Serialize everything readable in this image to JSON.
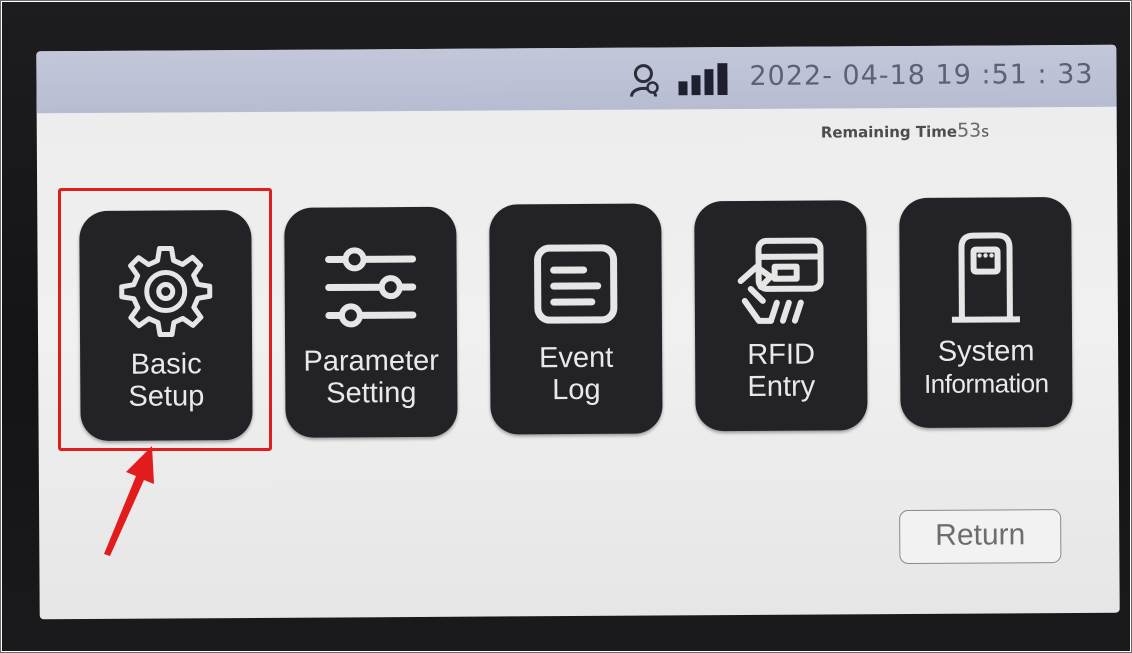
{
  "status_bar": {
    "datetime": "2022- 04-18  19 :51 : 33",
    "icons": [
      "user-icon",
      "signal-icon"
    ]
  },
  "remaining": {
    "label": "Remaining Time",
    "value": "53",
    "unit": "s"
  },
  "tiles": [
    {
      "line1": "Basic",
      "line2": "Setup",
      "icon": "gear-icon"
    },
    {
      "line1": "Parameter",
      "line2": "Setting",
      "icon": "sliders-icon"
    },
    {
      "line1": "Event",
      "line2": "Log",
      "icon": "document-icon"
    },
    {
      "line1": "RFID",
      "line2": "Entry",
      "icon": "card-tap-icon"
    },
    {
      "line1": "System",
      "line2": "Information",
      "icon": "charger-icon"
    }
  ],
  "return_button": {
    "label": "Return"
  },
  "annotation": {
    "box_color": "#e21c1c",
    "arrow_color": "#e21c1c"
  },
  "colors": {
    "tile_bg": "#232327",
    "status_bar": "#bcc0d5",
    "screen_bg": "#ececec"
  }
}
